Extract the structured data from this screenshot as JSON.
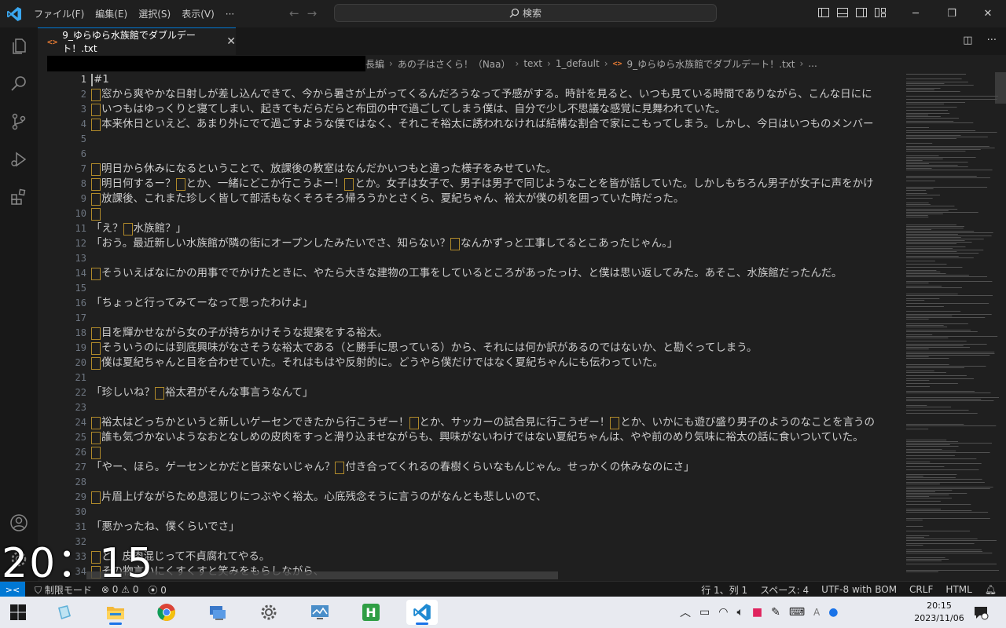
{
  "menu": [
    "ファイル(F)",
    "編集(E)",
    "選択(S)",
    "表示(V)",
    "···"
  ],
  "search": {
    "placeholder": "検索"
  },
  "tab": {
    "label": "9_ゆらゆら水族館でダブルデート！.txt",
    "icon": "<>"
  },
  "breadcrumb": [
    "長編",
    "あの子はさくら！（Naa）",
    "text",
    "1_default",
    "9_ゆらゆら水族館でダブルデート！.txt",
    "..."
  ],
  "editor": {
    "lines": [
      {
        "n": "1",
        "ws": false,
        "text": "#1"
      },
      {
        "n": "2",
        "ws": true,
        "text": "窓から爽やかな日射しが差し込んできて、今から暑さが上がってくるんだろうなって予感がする。時計を見ると、いつも見ている時間でありながら、こんな日にに"
      },
      {
        "n": "3",
        "ws": true,
        "text": "いつもはゆっくりと寝てしまい、起きてもだらだらと布団の中で過ごしてしまう僕は、自分で少し不思議な感覚に見舞われていた。"
      },
      {
        "n": "4",
        "ws": true,
        "text": "本来休日といえど、あまり外にでて過ごすような僕ではなく、それこそ裕太に誘われなければ結構な割合で家にこもってしまう。しかし、今日はいつものメンバー"
      },
      {
        "n": "5",
        "ws": false,
        "text": ""
      },
      {
        "n": "6",
        "ws": false,
        "text": ""
      },
      {
        "n": "7",
        "ws": true,
        "text": "明日から休みになるということで、放課後の教室はなんだかいつもと違った様子をみせていた。"
      },
      {
        "n": "8",
        "ws": true,
        "text": "明日何するー？▯とか、一緒にどこか行こうよー！▯とか。女子は女子で、男子は男子で同じようなことを皆が話していた。しかしもちろん男子が女子に声をかけ"
      },
      {
        "n": "9",
        "ws": true,
        "text": "放課後、これまた珍しく皆して部活もなくそろそろ帰ろうかとさくら、夏紀ちゃん、裕太が僕の机を囲っていた時だった。"
      },
      {
        "n": "10",
        "ws": true,
        "text": ""
      },
      {
        "n": "11",
        "ws": false,
        "text": "「え？▯水族館？」"
      },
      {
        "n": "12",
        "ws": false,
        "text": "「おう。最近新しい水族館が隣の街にオープンしたみたいでさ、知らない？▯なんかずっと工事してるとこあったじゃん。」"
      },
      {
        "n": "13",
        "ws": false,
        "text": ""
      },
      {
        "n": "14",
        "ws": true,
        "text": "そういえばなにかの用事ででかけたときに、やたら大きな建物の工事をしているところがあったっけ、と僕は思い返してみた。あそこ、水族館だったんだ。"
      },
      {
        "n": "15",
        "ws": false,
        "text": ""
      },
      {
        "n": "16",
        "ws": false,
        "text": "「ちょっと行ってみてーなって思ったわけよ」"
      },
      {
        "n": "17",
        "ws": false,
        "text": ""
      },
      {
        "n": "18",
        "ws": true,
        "text": "目を輝かせながら女の子が持ちかけそうな提案をする裕太。"
      },
      {
        "n": "19",
        "ws": true,
        "text": "そういうのには到底興味がなさそうな裕太である（と勝手に思っている）から、それには何か訳があるのではないか、と勘ぐってしまう。"
      },
      {
        "n": "20",
        "ws": true,
        "text": "僕は夏紀ちゃんと目を合わせていた。それはもはや反射的に。どうやら僕だけではなく夏紀ちゃんにも伝わっていた。"
      },
      {
        "n": "21",
        "ws": false,
        "text": ""
      },
      {
        "n": "22",
        "ws": false,
        "text": "「珍しいね？▯裕太君がそんな事言うなんて」"
      },
      {
        "n": "23",
        "ws": false,
        "text": ""
      },
      {
        "n": "24",
        "ws": true,
        "text": "裕太はどっちかというと新しいゲーセンできたから行こうぜー！▯とか、サッカーの試合見に行こうぜー！▯とか、いかにも遊び盛り男子のようのなことを言うの"
      },
      {
        "n": "25",
        "ws": true,
        "text": "誰も気づかないようなおとなしめの皮肉をすっと滑り込ませながらも、興味がないわけではない夏紀ちゃんは、やや前のめり気味に裕太の話に食いついていた。"
      },
      {
        "n": "26",
        "ws": true,
        "text": ""
      },
      {
        "n": "27",
        "ws": false,
        "text": "「やー、ほら。ゲーセンとかだと皆来ないじゃん？▯付き合ってくれるの春樹くらいなもんじゃん。せっかくの休みなのにさ」"
      },
      {
        "n": "28",
        "ws": false,
        "text": ""
      },
      {
        "n": "29",
        "ws": true,
        "text": "片眉上げながらため息混じりにつぶやく裕太。心底残念そうに言うのがなんとも悲しいので、"
      },
      {
        "n": "30",
        "ws": false,
        "text": ""
      },
      {
        "n": "31",
        "ws": false,
        "text": "「悪かったね、僕くらいでさ」"
      },
      {
        "n": "32",
        "ws": false,
        "text": ""
      },
      {
        "n": "33",
        "ws": true,
        "text": "と、皮肉混じって不貞腐れてやる。"
      },
      {
        "n": "34",
        "ws": true,
        "text": "その物言いにくすくすと笑みをもらしながら、"
      }
    ]
  },
  "status": {
    "remote": "><",
    "mode": "制限モード",
    "errors": "0",
    "warnings": "0",
    "ports": "0",
    "position": "行 1、列 1",
    "spaces": "スペース: 4",
    "encoding": "UTF-8 with BOM",
    "eol": "CRLF",
    "language": "HTML"
  },
  "clock_overlay": "20：15",
  "taskbar": {
    "time": "20:15",
    "date": "2023/11/06",
    "ime": "A"
  }
}
